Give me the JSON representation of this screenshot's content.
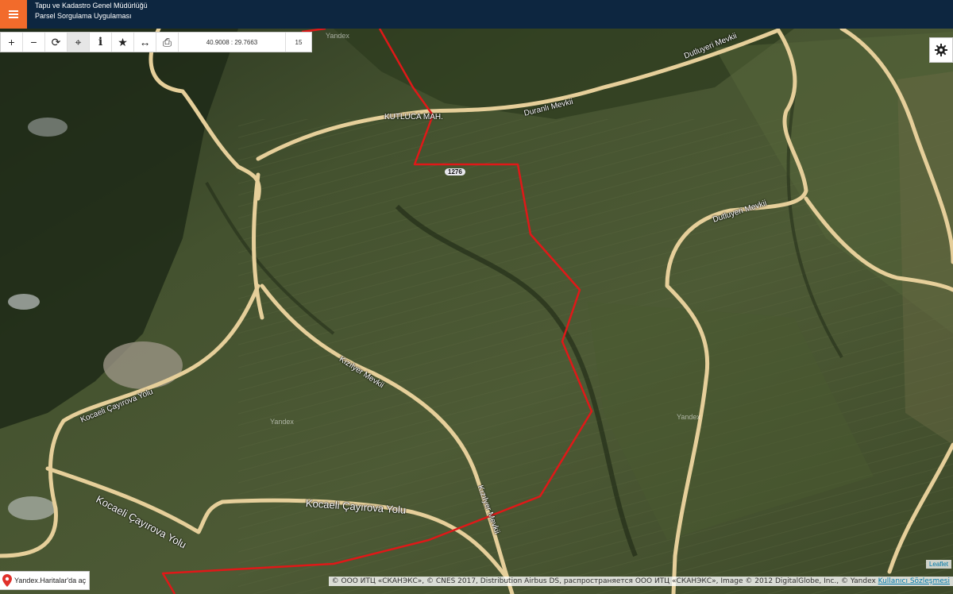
{
  "header": {
    "title_line1": "Tapu ve Kadastro Genel Müdürlüğü",
    "title_line2": "Parsel Sorgulama Uygulaması",
    "menu_icon": "hamburger-icon",
    "accent_color": "#f26b2b",
    "bar_color": "#0d2640"
  },
  "toolbar": {
    "tools": [
      {
        "icon": "zoom-in-icon",
        "glyph": "+"
      },
      {
        "icon": "zoom-out-icon",
        "glyph": "−"
      },
      {
        "icon": "refresh-icon",
        "glyph": "⟳"
      },
      {
        "icon": "locate-icon",
        "glyph": "⌖"
      },
      {
        "icon": "info-icon",
        "glyph": "i"
      },
      {
        "icon": "star-icon",
        "glyph": "★"
      },
      {
        "icon": "measure-icon",
        "glyph": "↔"
      },
      {
        "icon": "print-icon",
        "glyph": "⎙"
      }
    ],
    "coordinates": "40.9008 : 29.7663",
    "zoom_level": "15"
  },
  "settings": {
    "icon": "gear-icon"
  },
  "map": {
    "road_labels": [
      "Dutluyeri Mevkii",
      "Duranlı Mevkii",
      "KUTLUCA MAH.",
      "Dutluyeri Mevkii",
      "Kızılyer Mevkii",
      "Kocaeli Çayırova Yolu",
      "Kocaeli Çayırova Yolu",
      "Kocaeli Çayırova Yolu",
      "Kızılyer Mevkii"
    ],
    "watermarks": [
      "Yandex",
      "Yandex",
      "Yandex"
    ],
    "parcel_number": "1276",
    "parcel_color": "#e01818"
  },
  "yandex_link": {
    "label": "Yandex.Haritalar'da aç",
    "icon": "map-pin-icon",
    "pin_color": "#e0302a"
  },
  "footer": {
    "leaflet": "Leaflet",
    "attribution": "© ООО ИТЦ «СКАНЭКС», © CNES 2017, Distribution Airbus DS, распространяется ООО ИТЦ «СКАНЭКС», Image © 2012 DigitalGlobe, Inc., © Yandex ",
    "terms_link": "Kullanıcı Sözleşmesi"
  }
}
